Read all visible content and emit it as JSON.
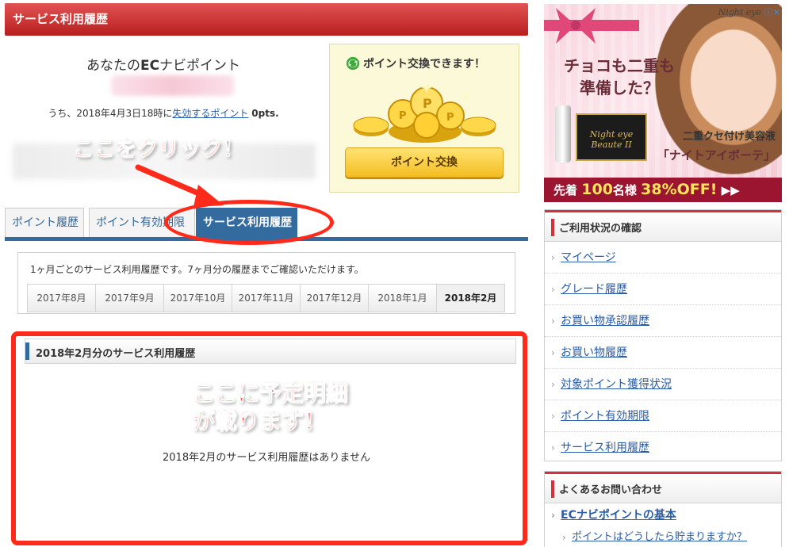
{
  "header": {
    "title": "サービス利用履歴"
  },
  "points": {
    "title_prefix": "あなたの",
    "title_bold": "EC",
    "title_suffix": "ナビポイント",
    "expire_prefix": "うち、2018年4月3日18時に",
    "expire_link": "失効するポイント",
    "expire_value": "0pts."
  },
  "exchange": {
    "title": "ポイント交換できます！",
    "button_label": "ポイント交換"
  },
  "annotations": {
    "click_here": "ここをクリック！",
    "details_line1": "ここに予定明細",
    "details_line2": "が載ります！",
    "highlight_color": "#ff2a1a"
  },
  "tabs": [
    {
      "label": "ポイント履歴"
    },
    {
      "label": "ポイント有効期限"
    },
    {
      "label": "サービス利用履歴",
      "active": true
    }
  ],
  "months": {
    "description": "1ヶ月ごとのサービス利用履歴です。7ヶ月分の履歴までご確認いただけます。",
    "items": [
      "2017年8月",
      "2017年9月",
      "2017年10月",
      "2017年11月",
      "2017年12月",
      "2018年1月",
      "2018年2月"
    ],
    "selected": "2018年2月"
  },
  "history": {
    "title": "2018年2月分のサービス利用履歴",
    "empty_message": "2018年2月のサービス利用履歴はありません"
  },
  "ad": {
    "logo": "Night eye",
    "close": "ⓘ✕",
    "headline_line1": "チョコも二重も",
    "headline_line2": "準備した？",
    "box_label": "Night eye Beaute II",
    "subtitle": "二重クセ付け美容液",
    "product": "「ナイトアイボーテ」",
    "footer_prefix": "先着",
    "footer_num": "100",
    "footer_mid": "名様",
    "footer_pct": "38%OFF!",
    "footer_arrows": "▶▶"
  },
  "sidebar": {
    "status_title": "ご利用状況の確認",
    "status_items": [
      "マイページ",
      "グレード履歴",
      "お買い物承認履歴",
      "お買い物履歴",
      "対象ポイント獲得状況",
      "ポイント有効期限",
      "サービス利用履歴"
    ],
    "faq_title": "よくあるお問い合わせ",
    "faq_main": "ECナビポイントの基本",
    "faq_sub": "ポイントはどうしたら貯まりますか？"
  },
  "colors": {
    "header_red": "#c72a2a",
    "tab_blue": "#336b9f",
    "link_blue": "#2a5ca8",
    "button_gold": "#f4bd22"
  }
}
